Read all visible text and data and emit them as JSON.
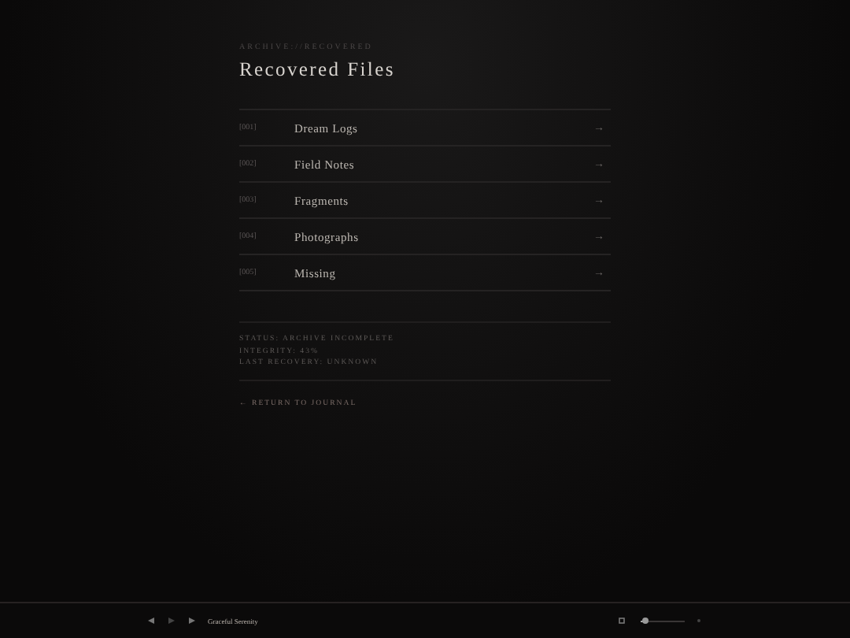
{
  "breadcrumb": "ARCHIVE://RECOVERED",
  "title": "Recovered Files",
  "files": [
    {
      "number": "[001]",
      "name": "Dream Logs",
      "arrow": "→"
    },
    {
      "number": "[002]",
      "name": "Field Notes",
      "arrow": "→"
    },
    {
      "number": "[003]",
      "name": "Fragments",
      "arrow": "→"
    },
    {
      "number": "[004]",
      "name": "Photographs",
      "arrow": "→"
    },
    {
      "number": "[005]",
      "name": "Missing",
      "arrow": "→"
    }
  ],
  "status_lines": [
    "STATUS: ARCHIVE INCOMPLETE",
    "INTEGRITY: 43%",
    "LAST RECOVERY: UNKNOWN"
  ],
  "back_link": "← RETURN TO JOURNAL",
  "player": {
    "track": "Graceful Serenity",
    "playing": false,
    "volume": {
      "level": 0.1
    }
  }
}
